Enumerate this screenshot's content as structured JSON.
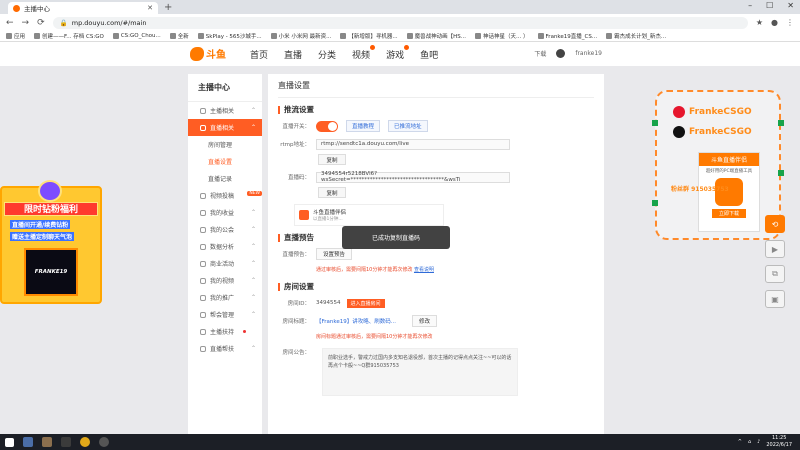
{
  "browser": {
    "tab_title": "主播中心",
    "url": "mp.douyu.com/#/main",
    "bookmarks": [
      "应用",
      "创建——F... 存档 CS:GO",
      "CS:GO_Chou...",
      "全新",
      "SkPlay - 565沙城手...",
      "小米 小米网 最新资...",
      "【新增版】寻机器...",
      "魔兽战神动画【HS...",
      "神话神星（天... ）",
      "Franke19直播_CS...",
      "霸杰成长计划_新杰..."
    ]
  },
  "site": {
    "logo_text": "斗鱼",
    "nav": [
      "首页",
      "直播",
      "分类",
      "视频",
      "游戏",
      "鱼吧"
    ],
    "download_label": "下载",
    "username": "franke19"
  },
  "sidebar": {
    "title": "主播中心",
    "items": [
      {
        "label": "主播相关",
        "active": false
      },
      {
        "label": "直播相关",
        "active": true
      },
      {
        "label": "房间管理",
        "sub": true
      },
      {
        "label": "直播设置",
        "sub": true,
        "current": true
      },
      {
        "label": "直播记录",
        "sub": true
      },
      {
        "label": "视频投稿",
        "badge": "NEW"
      },
      {
        "label": "我的收益"
      },
      {
        "label": "我的公会"
      },
      {
        "label": "数据分析"
      },
      {
        "label": "商业活动"
      },
      {
        "label": "我的视频"
      },
      {
        "label": "我的推广"
      },
      {
        "label": "帮会管理"
      },
      {
        "label": "主播扶持"
      },
      {
        "label": "直播帮扶"
      }
    ]
  },
  "main": {
    "page_title": "直播设置",
    "stream_section": {
      "title": "推流设置",
      "switch_label": "直播开关：",
      "tutorial_link": "直播教程",
      "record_link": "已推流地址",
      "rtmp_label": "rtmp地址：",
      "rtmp_value": "rtmp://sendtc1a.douyu.com/live",
      "copy_label": "复制",
      "code_label": "直播码：",
      "code_value": "3494554r5218BVl6?wsSecret=**********************************&wsTi",
      "promo_title": "斗鱼直播伴侣",
      "promo_sub": "以直播1分钟..."
    },
    "preview_section": {
      "title": "直播预告",
      "label": "直播预告：",
      "button": "设置预告",
      "hint": "通过审核后，需要间隔10分钟才能再次修改",
      "hint_link": "查看说明"
    },
    "room_section": {
      "title": "房间设置",
      "room_id_label": "房间ID：",
      "room_id": "3494554",
      "enter_button": "进入直播房间",
      "room_name_label": "房间标题：",
      "room_name": "【Franke19】讲攻略、刷数码...",
      "edit_button": "修改",
      "name_hint": "房间标题通过审核后，需要间隔10分钟才能再次修改",
      "notice_label": "房间公告：",
      "notice_text": "前职业选手，警戒力过国内多支知名退役部，首次主播的记得点点关注~~可以的话再点个卡般~~Q群915035753"
    },
    "toast": "已成功复制直播码"
  },
  "left_promo": {
    "banner": "限时钻粉福利",
    "line1": "直播间开通/续费钻粉",
    "line2": "赠送主播定制聊天气泡",
    "card_name": "FRANKE19"
  },
  "right_overlay": {
    "weibo": "FrankeCSGO",
    "douyin": "FrankeCSGO",
    "tool_title": "斗鱼直播伴侣",
    "tool_sub": "超好用的PC端直播工具",
    "download": "立即下载",
    "fans": "粉丝群 915035753"
  },
  "taskbar": {
    "time": "11:25",
    "date": "2022/6/17"
  },
  "colors": {
    "accent": "#ff5d23",
    "link": "#2f6bd8"
  }
}
